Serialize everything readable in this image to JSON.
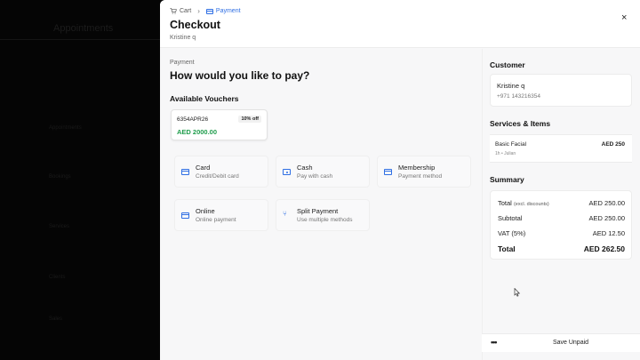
{
  "background": {
    "title": "Appointments",
    "items": [
      "Appointments",
      "Bookings",
      "Services",
      "Clients",
      "Sales"
    ]
  },
  "header": {
    "breadcrumb": [
      {
        "label": "Cart",
        "icon": "cart-icon"
      },
      {
        "label": "Payment",
        "icon": "credit-card-icon"
      }
    ],
    "title": "Checkout",
    "customer_name": "Kristine q",
    "close_symbol": "×"
  },
  "payment": {
    "section_label": "Payment",
    "question": "How would you like to pay?",
    "vouchers_title": "Available Vouchers",
    "vouchers": [
      {
        "code": "6354APR26",
        "badge": "10% off",
        "amount": "AED 2000.00"
      }
    ],
    "methods": [
      {
        "name": "Card",
        "description": "Credit/Debit card",
        "icon": "credit-card-icon"
      },
      {
        "name": "Cash",
        "description": "Pay with cash",
        "icon": "cash-icon"
      },
      {
        "name": "Membership",
        "description": "Payment method",
        "icon": "membership-card-icon"
      },
      {
        "name": "Online",
        "description": "Online payment",
        "icon": "online-payment-icon"
      },
      {
        "name": "Split Payment",
        "description": "Use multiple methods",
        "icon": "split-icon"
      }
    ]
  },
  "sidebar": {
    "customer_title": "Customer",
    "customer_name": "Kristine q",
    "customer_phone": "+971 143216354",
    "services_title": "Services & Items",
    "services": [
      {
        "name": "Basic Facial",
        "meta": "1h • Julian",
        "price": "AED 250"
      }
    ],
    "summary_title": "Summary",
    "summary": {
      "total_excl_label": "Total",
      "total_excl_note": "(excl. discounts)",
      "total_excl_value": "AED 250.00",
      "subtotal_label": "Subtotal",
      "subtotal_value": "AED 250.00",
      "vat_label": "VAT (5%)",
      "vat_value": "AED 12.50",
      "total_label": "Total",
      "total_value": "AED 262.50"
    }
  },
  "footer": {
    "more_label": "•••",
    "save_label": "Save Unpaid"
  },
  "colors": {
    "accent": "#2f6fe4",
    "voucher_green": "#1f9d4c",
    "overlay": "#0b0b0b"
  }
}
